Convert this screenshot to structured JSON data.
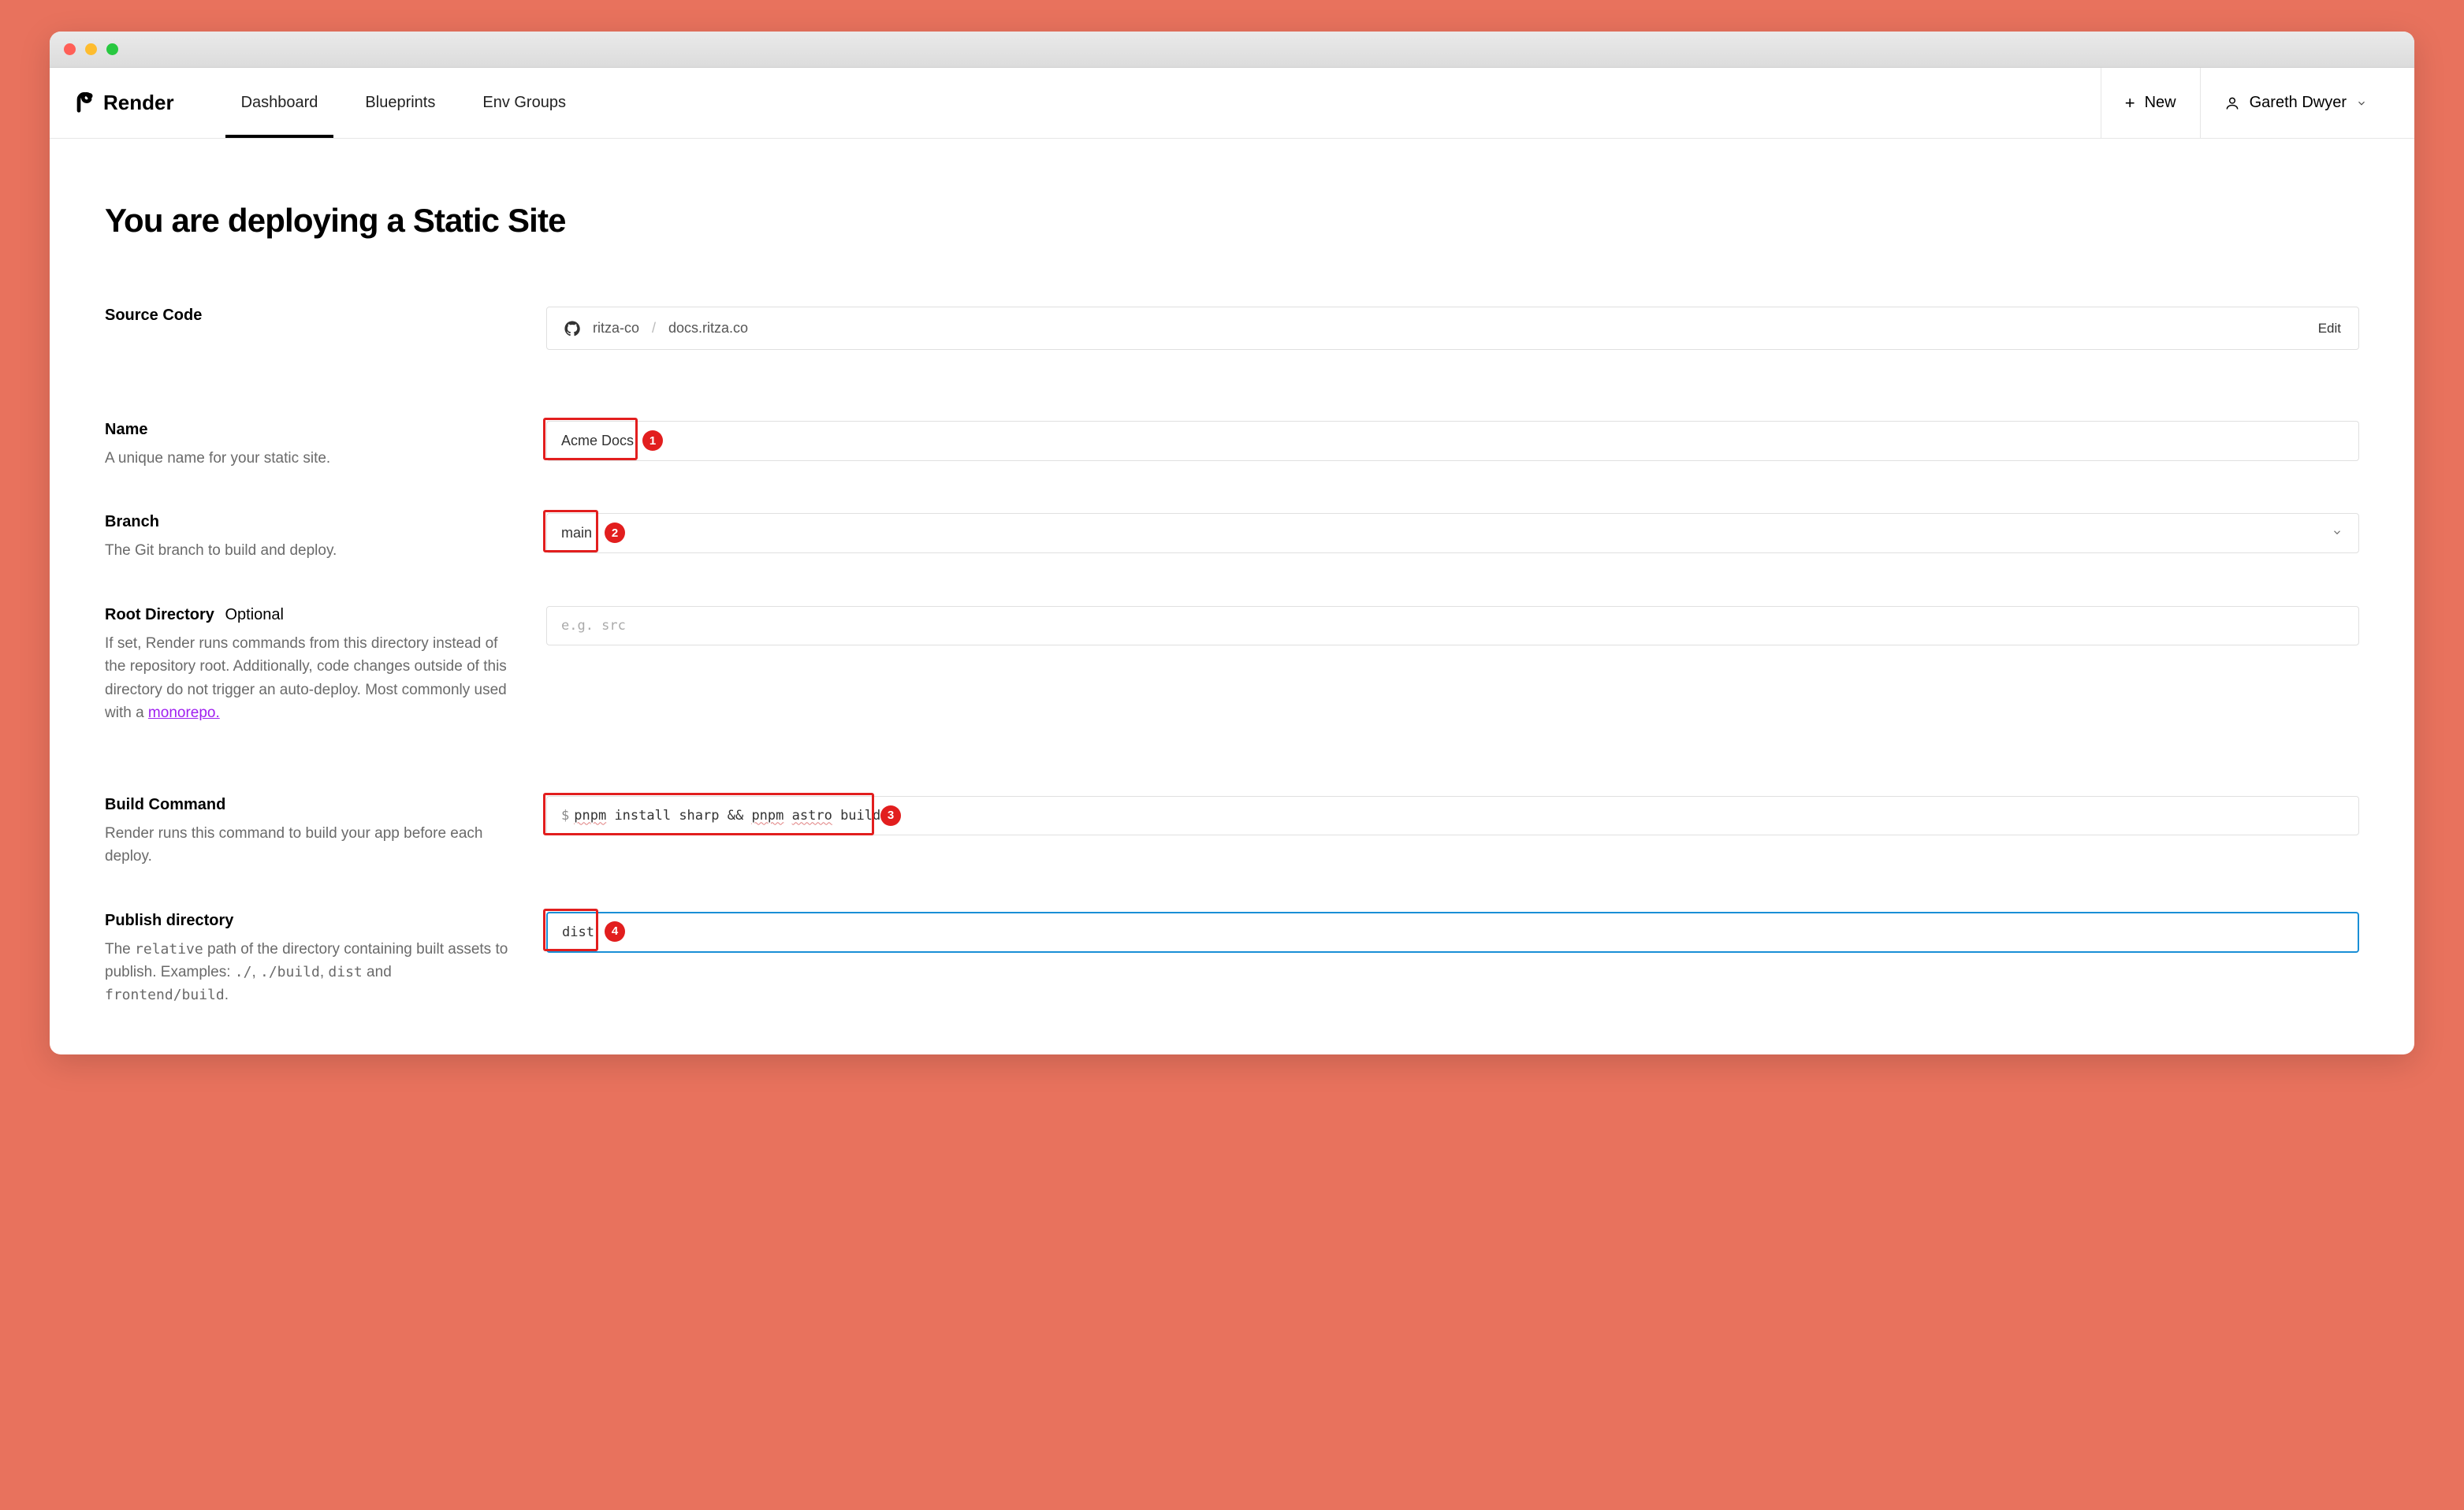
{
  "logo": "Render",
  "nav": {
    "tabs": [
      "Dashboard",
      "Blueprints",
      "Env Groups"
    ],
    "new": "New",
    "user": "Gareth Dwyer"
  },
  "page_title": "You are deploying a Static Site",
  "fields": {
    "source": {
      "label": "Source Code",
      "org": "ritza-co",
      "sep": "/",
      "repo": "docs.ritza.co",
      "edit": "Edit"
    },
    "name": {
      "label": "Name",
      "hint": "A unique name for your static site.",
      "value": "Acme Docs",
      "badge": "1"
    },
    "branch": {
      "label": "Branch",
      "hint": "The Git branch to build and deploy.",
      "value": "main",
      "badge": "2"
    },
    "rootdir": {
      "label": "Root Directory",
      "optional": "Optional",
      "hint_pre": "If set, Render runs commands from this directory instead of the repository root. Additionally, code changes outside of this directory do not trigger an auto-deploy. Most commonly used with a ",
      "hint_link": "monorepo.",
      "placeholder": "e.g. src"
    },
    "build": {
      "label": "Build Command",
      "hint": "Render runs this command to build your app before each deploy.",
      "prefix": "$",
      "value_parts": {
        "p1": "pnpm",
        "p2": " install sharp && ",
        "p3": "pnpm",
        "p4": " ",
        "p5": "astro",
        "p6": " build"
      },
      "badge": "3"
    },
    "publish": {
      "label": "Publish directory",
      "hint_pre": "The ",
      "hint_c1": "relative",
      "hint_mid": " path of the directory containing built assets to publish. Examples: ",
      "hint_c2": "./",
      "hint_sep1": ", ",
      "hint_c3": "./build",
      "hint_sep2": ", ",
      "hint_c4": "dist",
      "hint_sep3": " and ",
      "hint_c5": "frontend/build",
      "hint_end": ".",
      "value": "dist",
      "badge": "4"
    }
  }
}
